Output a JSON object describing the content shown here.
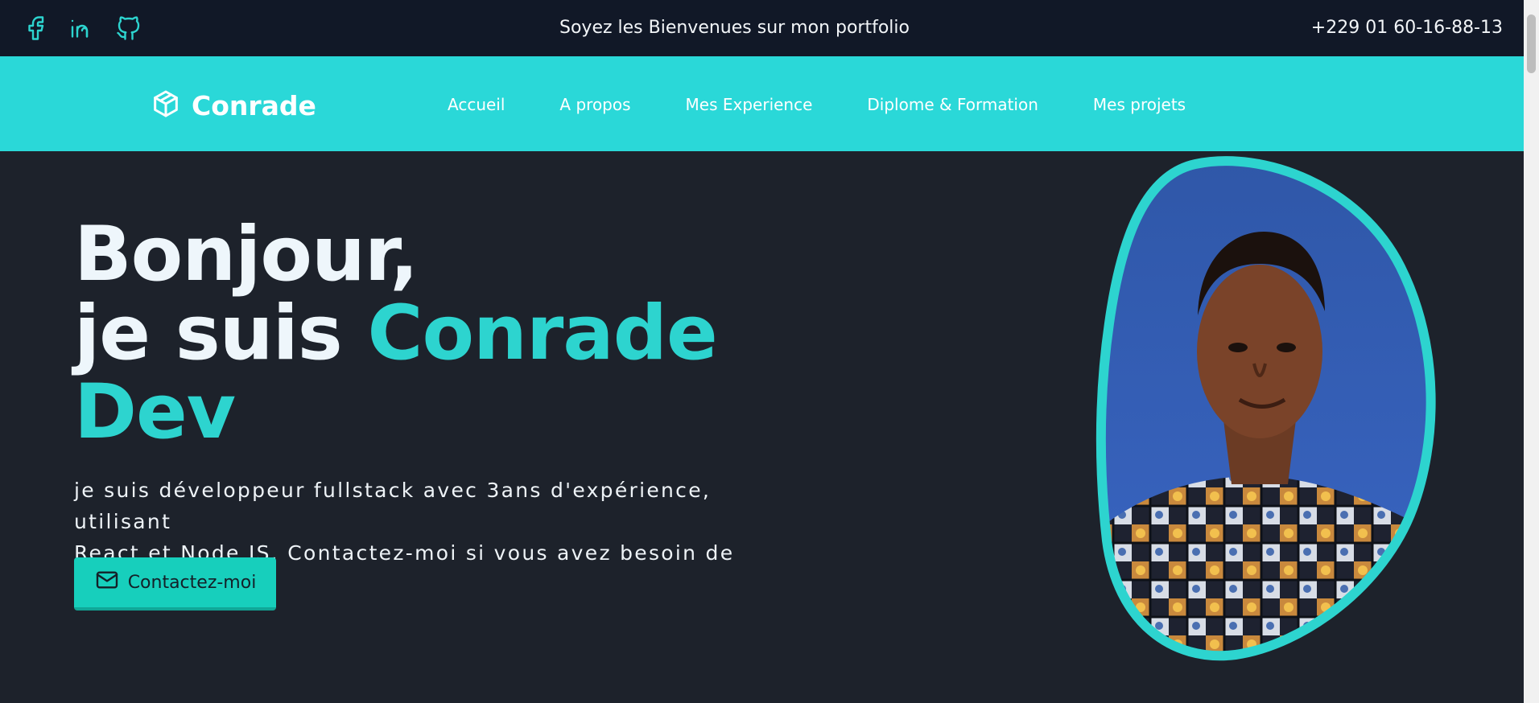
{
  "topbar": {
    "socials": [
      {
        "icon": "facebook-icon"
      },
      {
        "icon": "linkedin-icon"
      },
      {
        "icon": "github-icon"
      }
    ],
    "welcome": "Soyez les Bienvenues sur mon portfolio",
    "phone": "+229 01 60-16-88-13"
  },
  "navbar": {
    "brand": "Conrade",
    "brand_icon": "cube-icon",
    "links": [
      "Accueil",
      "A propos",
      "Mes Experience",
      "Diplome & Formation",
      "Mes projets"
    ]
  },
  "hero": {
    "greeting": "Bonjour,",
    "intro": "je suis ",
    "name": "Conrade",
    "role": "Dev",
    "description_line1": "je suis développeur fullstack avec 3ans d'expérience, utilisant",
    "description_line2": "React et Node JS. Contactez-moi si vous avez besoin de",
    "contact_button": "Contactez-moi",
    "contact_icon": "mail-icon",
    "portrait_image": "portrait-photo"
  },
  "colors": {
    "accent": "#2dd4cf",
    "navbar_bg": "#2ad8d8",
    "topbar_bg": "#111827",
    "page_bg": "#1d222b",
    "button_bg": "#17cfbc"
  }
}
